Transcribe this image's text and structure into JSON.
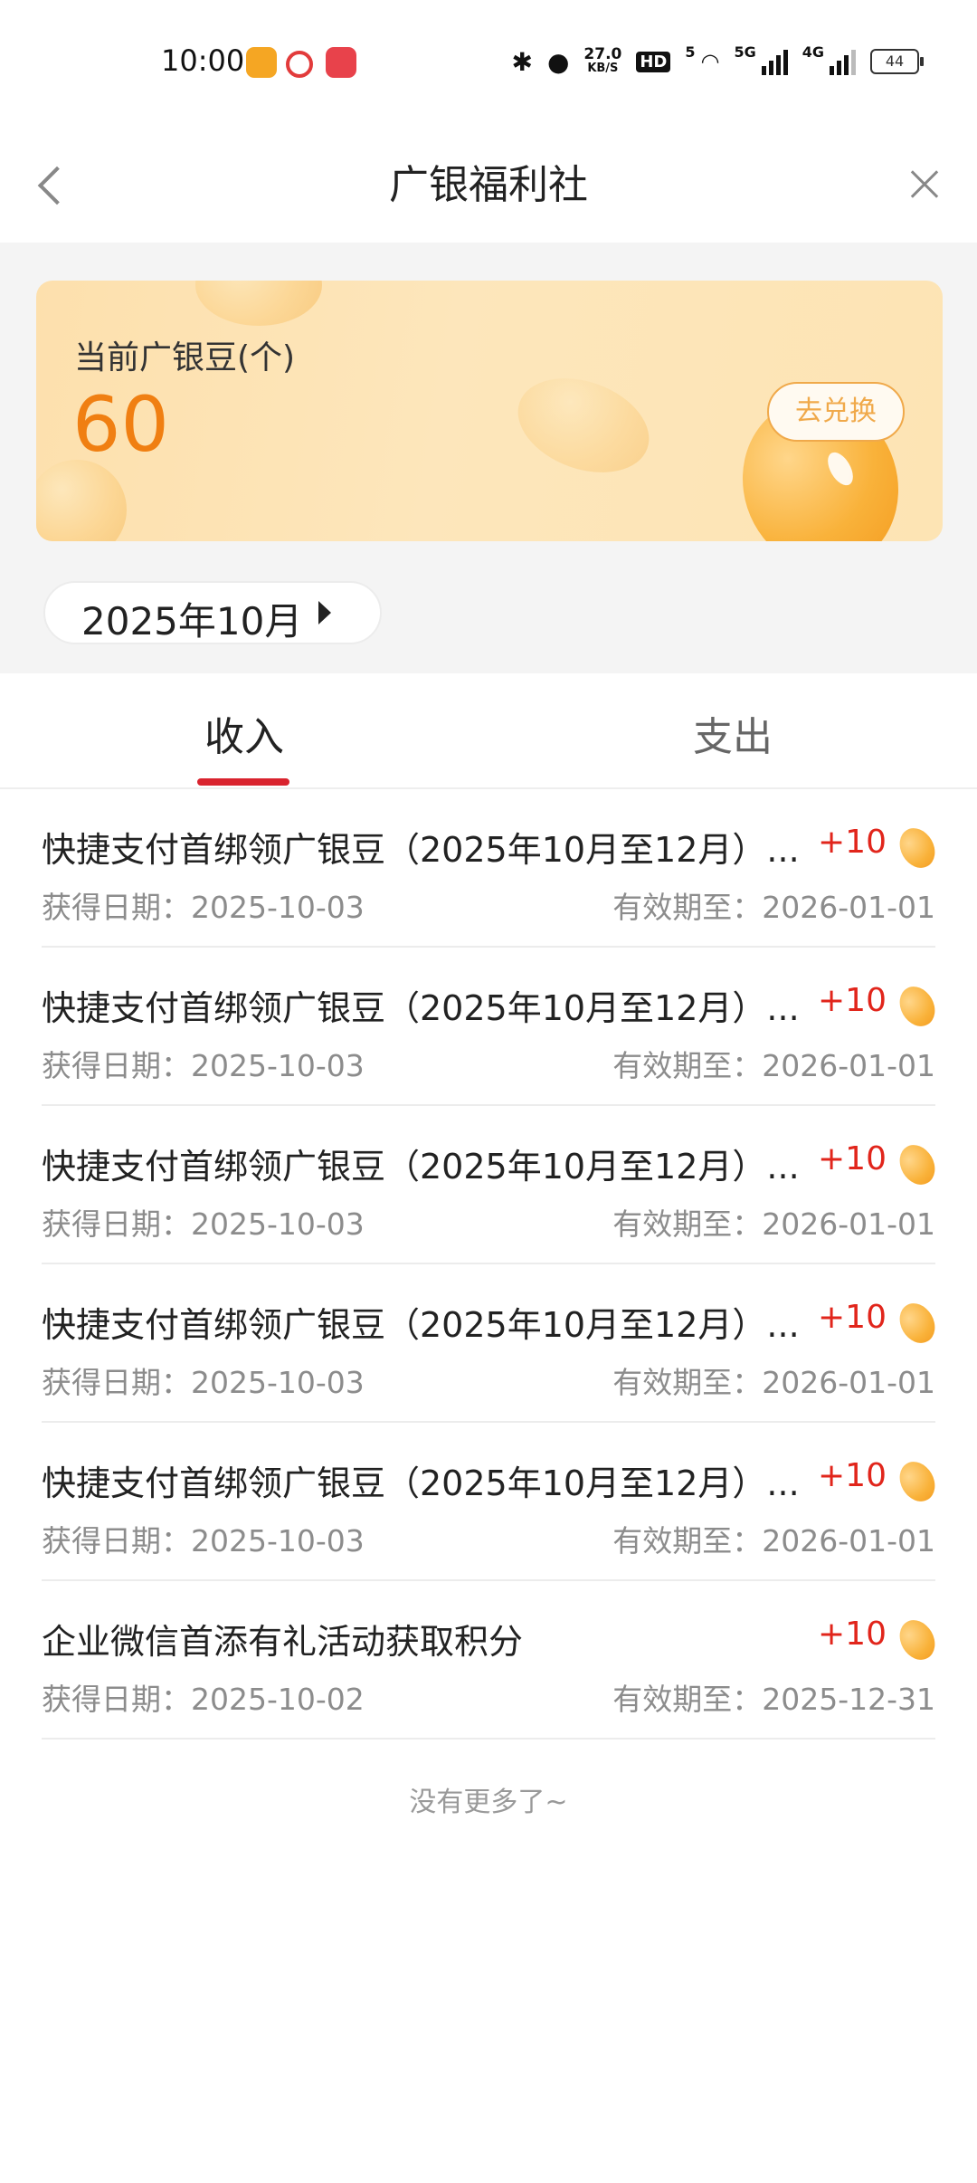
{
  "status_bar": {
    "time": "10:00",
    "net_speed_value": "27.0",
    "net_speed_unit": "KB/S",
    "hd": "HD",
    "signal1": "5G",
    "signal2": "4G",
    "wifi_label": "5",
    "battery": "44"
  },
  "header": {
    "title": "广银福利社"
  },
  "card": {
    "label": "当前广银豆(个)",
    "value": "60",
    "exchange_label": "去兑换"
  },
  "month_selector": {
    "label": "2025年10月"
  },
  "tabs": {
    "income": "收入",
    "expense": "支出"
  },
  "records": [
    {
      "title": "快捷支付首绑领广银豆（2025年10月至12月）...",
      "points": "+10",
      "date_label": "获得日期：2025-10-03",
      "expire_label": "有效期至：2026-01-01"
    },
    {
      "title": "快捷支付首绑领广银豆（2025年10月至12月）...",
      "points": "+10",
      "date_label": "获得日期：2025-10-03",
      "expire_label": "有效期至：2026-01-01"
    },
    {
      "title": "快捷支付首绑领广银豆（2025年10月至12月）...",
      "points": "+10",
      "date_label": "获得日期：2025-10-03",
      "expire_label": "有效期至：2026-01-01"
    },
    {
      "title": "快捷支付首绑领广银豆（2025年10月至12月）...",
      "points": "+10",
      "date_label": "获得日期：2025-10-03",
      "expire_label": "有效期至：2026-01-01"
    },
    {
      "title": "快捷支付首绑领广银豆（2025年10月至12月）...",
      "points": "+10",
      "date_label": "获得日期：2025-10-03",
      "expire_label": "有效期至：2026-01-01"
    },
    {
      "title": "企业微信首添有礼活动获取积分",
      "points": "+10",
      "date_label": "获得日期：2025-10-02",
      "expire_label": "有效期至：2025-12-31"
    }
  ],
  "footer": {
    "no_more": "没有更多了~"
  },
  "colors": {
    "accent_red": "#d9232e",
    "points_red": "#e1251b",
    "bean_orange": "#f07f12"
  }
}
